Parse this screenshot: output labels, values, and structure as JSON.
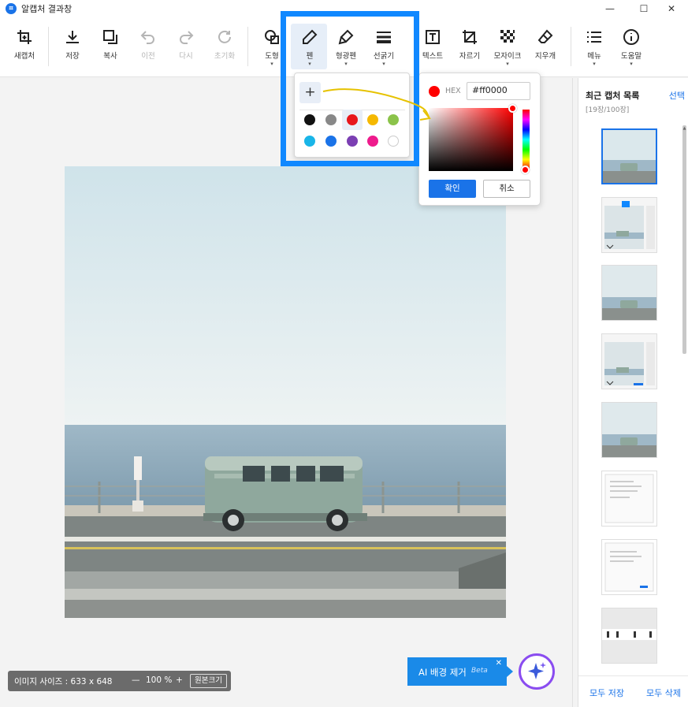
{
  "window": {
    "app_icon": "capture-app-icon",
    "title": "알캡처 결과창",
    "controls": [
      "—",
      "☐",
      "✕"
    ]
  },
  "toolbar": {
    "tools": [
      {
        "id": "new-capture",
        "label": "새캡처",
        "icon": "crop-icon"
      },
      {
        "id": "save",
        "label": "저장",
        "icon": "download-icon"
      },
      {
        "id": "copy",
        "label": "복사",
        "icon": "copy-icon"
      },
      {
        "id": "undo",
        "label": "이전",
        "icon": "undo-icon",
        "disabled": true
      },
      {
        "id": "redo",
        "label": "다시",
        "icon": "redo-icon",
        "disabled": true
      },
      {
        "id": "reset",
        "label": "초기화",
        "icon": "refresh-icon",
        "disabled": true
      },
      {
        "id": "shape",
        "label": "도형",
        "icon": "shapes-icon",
        "dropdown": true
      },
      {
        "id": "pen",
        "label": "펜",
        "icon": "pen-icon",
        "dropdown": true,
        "active": true
      },
      {
        "id": "highlighter",
        "label": "형광펜",
        "icon": "highlighter-icon",
        "dropdown": true
      },
      {
        "id": "line-thickness",
        "label": "선굵기",
        "icon": "line-weight-icon",
        "dropdown": true
      },
      {
        "id": "text",
        "label": "텍스트",
        "icon": "text-icon"
      },
      {
        "id": "crop",
        "label": "자르기",
        "icon": "crop-tool-icon"
      },
      {
        "id": "mosaic",
        "label": "모자이크",
        "icon": "mosaic-icon",
        "dropdown": true
      },
      {
        "id": "eraser",
        "label": "지우개",
        "icon": "eraser-icon"
      },
      {
        "id": "menu",
        "label": "메뉴",
        "icon": "list-icon",
        "dropdown": true
      },
      {
        "id": "help",
        "label": "도움말",
        "icon": "info-icon",
        "dropdown": true
      }
    ]
  },
  "palette": {
    "add_label": "+",
    "colors": [
      "#111111",
      "#888888",
      "#e8161b",
      "#f5b800",
      "#8bc34a",
      "#19b5e8",
      "#1a73e8",
      "#7b3fb3",
      "#ee1b8c",
      "#ffffff"
    ],
    "selected_index": 2
  },
  "color_picker": {
    "current_color": "#ff0000",
    "hex_label": "HEX",
    "hex_value": "#ff0000",
    "confirm_label": "확인",
    "cancel_label": "취소"
  },
  "recent": {
    "title": "최근 캡처 목록",
    "select_label": "선택",
    "count": "[19장/100장]",
    "save_all": "모두 저장",
    "delete_all": "모두 삭제"
  },
  "status": {
    "image_size_label": "이미지 사이즈 : 633 x 648",
    "zoom_minus": "—",
    "zoom_value": "100 %",
    "zoom_plus": "+",
    "original_size": "원본크기"
  },
  "ai": {
    "label": "AI 배경 제거",
    "beta": "Beta",
    "close": "✕"
  },
  "colors": {
    "accent": "#1a73e8",
    "highlight_border": "#1088ff",
    "ai_ring": "#8a4cf0"
  }
}
